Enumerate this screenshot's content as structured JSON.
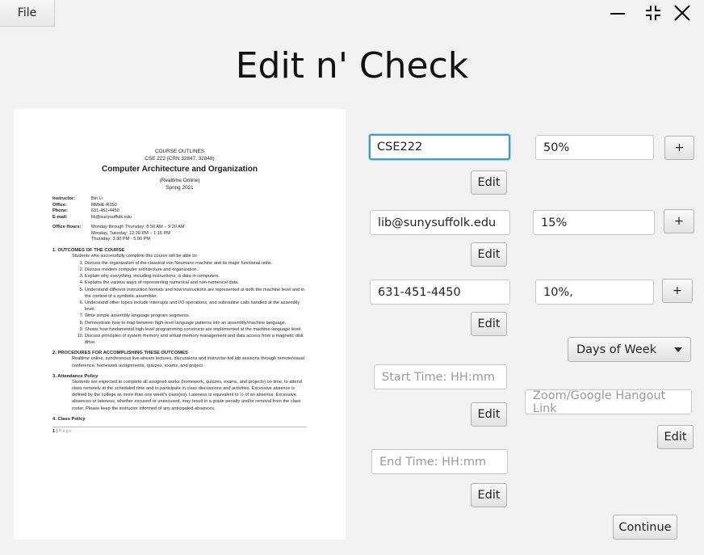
{
  "menu": {
    "file_label": "File"
  },
  "app": {
    "title": "Edit n' Check"
  },
  "document": {
    "heading1": "COURSE OUTLINES",
    "heading2": "CSE 222 (CRN 32847, 32848)",
    "course_title": "Computer Architecture and Organization",
    "mode": "(Realtime Online)",
    "term": "Spring 2021",
    "info": [
      {
        "key": "Instructor:",
        "value": "Bin Li"
      },
      {
        "key": "Office:",
        "value": "RMHE-R350"
      },
      {
        "key": "Phone:",
        "value": "631-451-4450"
      },
      {
        "key": "E-mail:",
        "value": "lib@sunysuffolk.edu"
      }
    ],
    "office_hours_key": "Office Hours:",
    "office_hours": [
      "Monday through Thursday: 8:50 AM – 9:20 AM",
      "Monday, Tuesday: 12:30 PM – 1:15 PM",
      "Thursday: 3:30 PM - 5:00 PM"
    ],
    "section1": "1. OUTCOMES OF THE COURSE",
    "section1_intro": "Students who successfully complete this course will be able to:",
    "outcomes": [
      "Discuss the organization of the classical von Neumann machine and its major functional units.",
      "Discuss modern computer architecture and organization.",
      "Explain why everything, including instructions, is data in computers.",
      "Explains the various ways of representing numerical and non-numerical data.",
      "Understand different instruction formats and how instructions are represented at both the machine level and in the context of a symbolic assembler.",
      "Understand other topics include interrupts and I/O operations, and subroutine calls handled at the assembly level.",
      "Write simple assembly language program segments.",
      "Demonstrate how to map between high-level language patterns into an assembly/machine language.",
      "Shows how fundamental high-level programming constructs are implemented at the machine-language level.",
      "Discuss principles of system memory and virtual memory management and data access from a magnetic disk drive."
    ],
    "section2": "2. PROCEDURES FOR ACCOMPLISHING THESE OUTCOMES",
    "section2_text": "Realtime online, synchronous live-stream lectures, discussions and instructor-led lab sessions through remote/visual conference; homework assignments, quizzes, exams, and project.",
    "section3": "3. Attendance Policy",
    "section3_text": "Students are expected to complete all assigned works (homework, quizzes, exams, and projects) on time, to attend class remotely at the scheduled time and to participate in class discussions and activities. Excessive absence is defined by the college as more than one week's class(es). Lateness is equivalent to ½ of an absence. Excessive absences or lateness, whether excused or unexcused, may result in a grade penalty and/or removal from the class roster. Please keep the instructor informed of any anticipated absences.",
    "section4": "4. Class Policy",
    "page_num": "1",
    "page_label": "Page"
  },
  "form": {
    "course_value": "CSE222",
    "percent1_value": "50%",
    "email_value": "lib@sunysuffolk.edu",
    "percent2_value": "15%",
    "phone_value": "631-451-4450",
    "percent3_value": "10%,",
    "start_time_placeholder": "Start Time: HH:mm",
    "end_time_placeholder": "End Time: HH:mm",
    "link_placeholder": "Zoom/Google Hangout Link",
    "days_selected": "Days of Week",
    "edit_label": "Edit",
    "plus_label": "+",
    "continue_label": "Continue"
  }
}
